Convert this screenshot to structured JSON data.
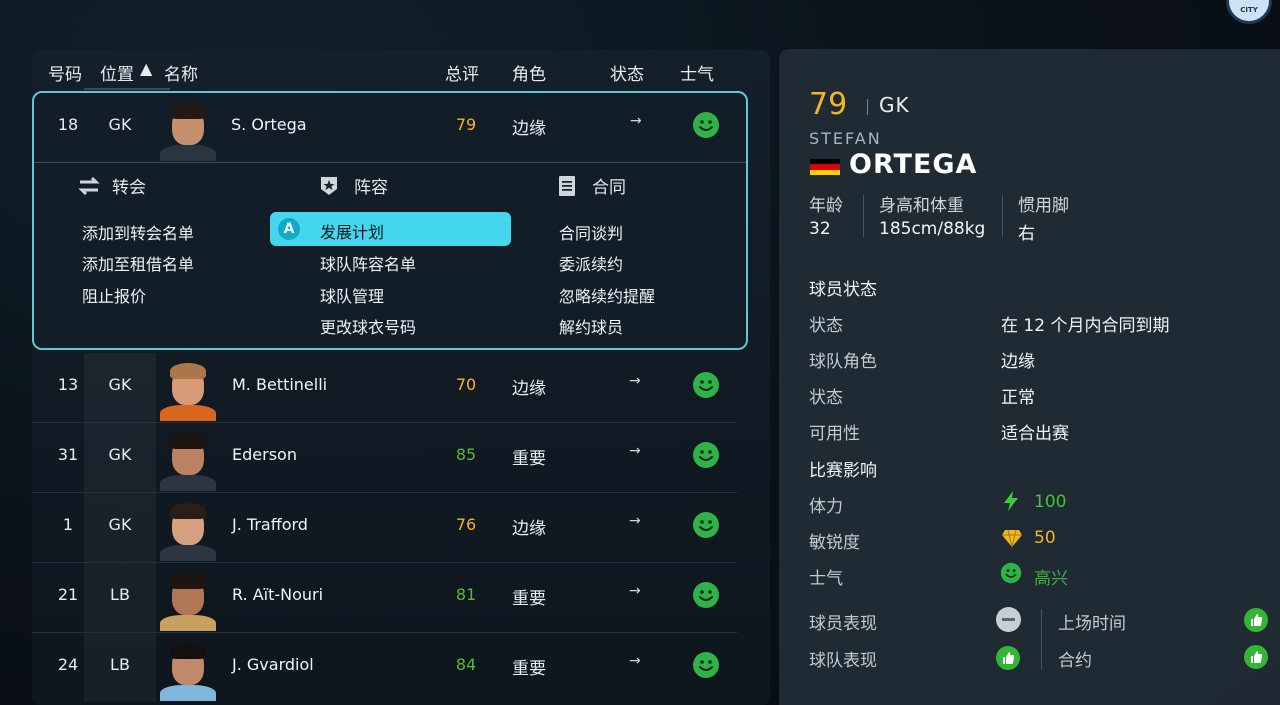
{
  "header": {
    "club_badge_text": "CITY"
  },
  "columns": {
    "number": "号码",
    "position": "位置",
    "sort_indicator": "▲",
    "name": "名称",
    "overall": "总评",
    "role": "角色",
    "status": "状态",
    "morale": "士气"
  },
  "players": [
    {
      "number": "18",
      "position": "GK",
      "name": "S. Ortega",
      "overall": "79",
      "overall_color": "#f2b623",
      "role": "边缘",
      "status_icon": "→",
      "morale_icon": "happy-face-icon"
    },
    {
      "number": "13",
      "position": "GK",
      "name": "M. Bettinelli",
      "overall": "70",
      "overall_color": "#f2b623",
      "role": "边缘",
      "status_icon": "→",
      "morale_icon": "happy-face-icon"
    },
    {
      "number": "31",
      "position": "GK",
      "name": "Ederson",
      "overall": "85",
      "overall_color": "#57b83a",
      "role": "重要",
      "status_icon": "→",
      "morale_icon": "happy-face-icon"
    },
    {
      "number": "1",
      "position": "GK",
      "name": "J. Trafford",
      "overall": "76",
      "overall_color": "#f2b623",
      "role": "边缘",
      "status_icon": "→",
      "morale_icon": "happy-face-icon"
    },
    {
      "number": "21",
      "position": "LB",
      "name": "R. Aït-Nouri",
      "overall": "81",
      "overall_color": "#57b83a",
      "role": "重要",
      "status_icon": "→",
      "morale_icon": "happy-face-icon"
    },
    {
      "number": "24",
      "position": "LB",
      "name": "J. Gvardiol",
      "overall": "84",
      "overall_color": "#57b83a",
      "role": "重要",
      "status_icon": "→",
      "morale_icon": "happy-face-icon"
    }
  ],
  "context_menu": {
    "transfer": {
      "heading": "转会",
      "items": [
        "添加到转会名单",
        "添加至租借名单",
        "阻止报价"
      ]
    },
    "squad": {
      "heading": "阵容",
      "items": [
        "发展计划",
        "球队阵容名单",
        "球队管理",
        "更改球衣号码"
      ],
      "selected_button": "A"
    },
    "contract": {
      "heading": "合同",
      "items": [
        "合同谈判",
        "委派续约",
        "忽略续约提醒",
        "解约球员"
      ]
    }
  },
  "detail": {
    "overall": "79",
    "position": "GK",
    "first_name": "STEFAN",
    "last_name": "ORTEGA",
    "flag_colors": [
      "#000000",
      "#dd0000",
      "#ffce00"
    ],
    "age_label": "年龄",
    "age": "32",
    "body_label": "身高和体重",
    "body": "185cm/88kg",
    "foot_label": "惯用脚",
    "foot": "右",
    "status_section": "球员状态",
    "status_rows": [
      {
        "label": "状态",
        "value": "在 12 个月内合同到期"
      },
      {
        "label": "球队角色",
        "value": "边缘"
      },
      {
        "label": "状态",
        "value": "正常"
      },
      {
        "label": "可用性",
        "value": "适合出赛"
      }
    ],
    "impact_section": "比赛影响",
    "stamina_label": "体力",
    "stamina": "100",
    "sharpness_label": "敏锐度",
    "sharpness": "50",
    "morale_label": "士气",
    "morale": "高兴",
    "player_perf_label": "球员表现",
    "team_perf_label": "球队表现",
    "playtime_label": "上场时间",
    "contract_label": "合约"
  }
}
